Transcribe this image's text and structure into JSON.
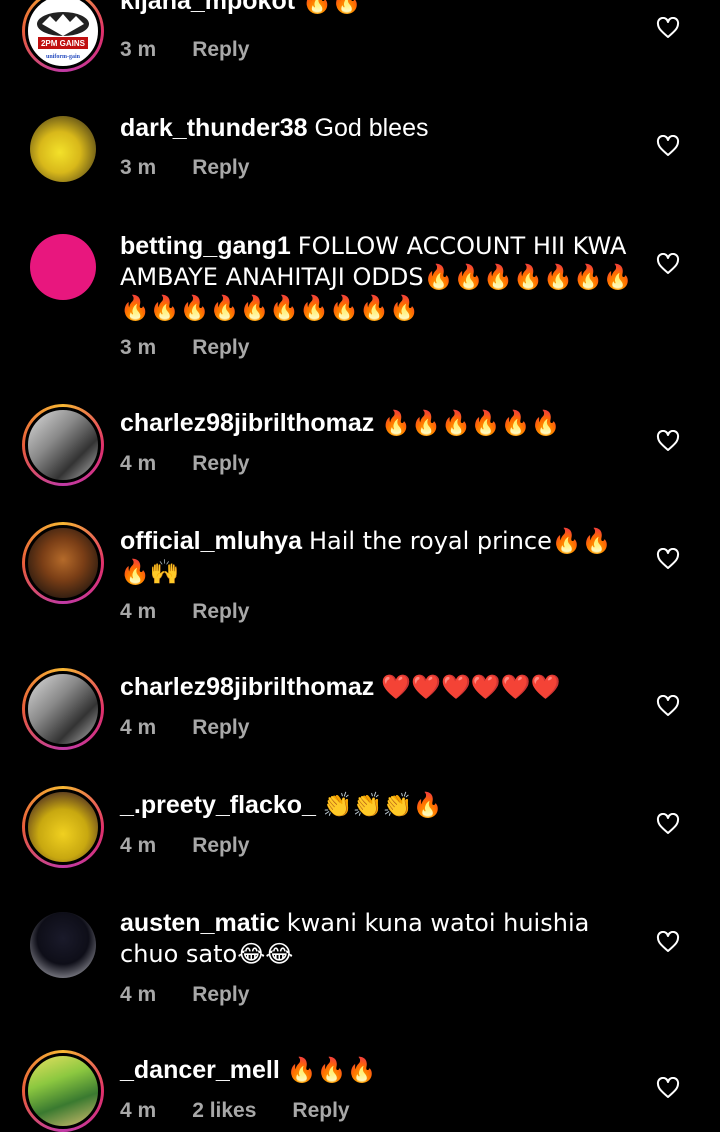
{
  "comments": [
    {
      "username": "kijana_mpokot",
      "text": "🔥🔥",
      "time": "3 m",
      "likes": "",
      "reply": "Reply",
      "avatar_text_top": "2PM GAINS",
      "avatar_text_bottom": "uniform-gain"
    },
    {
      "username": "dark_thunder38",
      "text": "God blees",
      "time": "3 m",
      "likes": "",
      "reply": "Reply"
    },
    {
      "username": "betting_gang1",
      "text": "FOLLOW ACCOUNT HII KWA AMBAYE ANAHITAJI ODDS🔥🔥🔥🔥🔥🔥🔥🔥🔥🔥🔥🔥🔥🔥🔥🔥🔥",
      "time": "3 m",
      "likes": "",
      "reply": "Reply"
    },
    {
      "username": "charlez98jibrilthomaz",
      "text": "🔥🔥🔥🔥🔥🔥",
      "time": "4 m",
      "likes": "",
      "reply": "Reply"
    },
    {
      "username": "official_mluhya",
      "text": "Hail the royal prince🔥🔥🔥🙌",
      "time": "4 m",
      "likes": "",
      "reply": "Reply"
    },
    {
      "username": "charlez98jibrilthomaz",
      "text": "❤️❤️❤️❤️❤️❤️",
      "time": "4 m",
      "likes": "",
      "reply": "Reply"
    },
    {
      "username": "_.preety_flacko_",
      "text": "👏👏👏🔥",
      "time": "4 m",
      "likes": "",
      "reply": "Reply"
    },
    {
      "username": "austen_matic",
      "text": "kwani kuna watoi huishia chuo sato😂😂",
      "time": "4 m",
      "likes": "",
      "reply": "Reply"
    },
    {
      "username": "_dancer_mell",
      "text": "🔥🔥🔥",
      "time": "4 m",
      "likes": "2 likes",
      "reply": "Reply"
    }
  ],
  "colors": {
    "background": "#000000",
    "text": "#ffffff",
    "meta": "#a8a8a8",
    "fire": "#ff8c1a",
    "heart_red": "#e02020",
    "avatar_pink": "#e8177e"
  },
  "icons": {
    "like": "heart-outline-icon"
  }
}
